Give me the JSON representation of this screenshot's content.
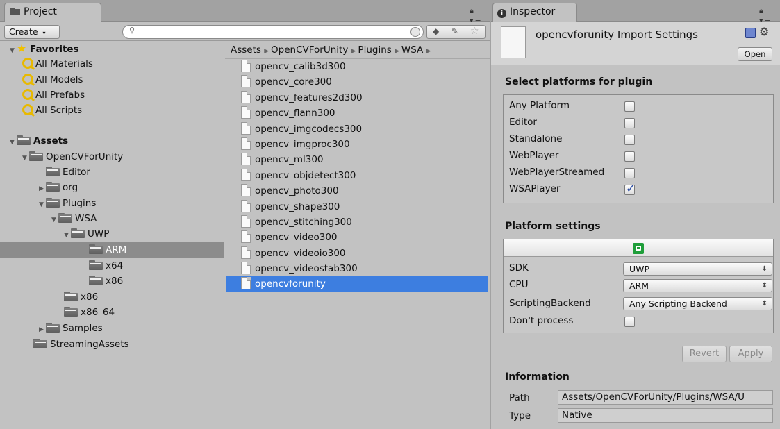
{
  "project": {
    "tab_label": "Project",
    "create_label": "Create",
    "search_placeholder": "",
    "favorites": {
      "label": "Favorites",
      "items": [
        "All Materials",
        "All Models",
        "All Prefabs",
        "All Scripts"
      ]
    },
    "tree": {
      "assets": "Assets",
      "opencv": "OpenCVForUnity",
      "editor": "Editor",
      "org": "org",
      "plugins": "Plugins",
      "wsa": "WSA",
      "uwp": "UWP",
      "arm": "ARM",
      "x64_uwp": "x64",
      "x86_uwp": "x86",
      "x86": "x86",
      "x86_64": "x86_64",
      "samples": "Samples",
      "streaming": "StreamingAssets"
    },
    "breadcrumb": [
      "Assets",
      "OpenCVForUnity",
      "Plugins",
      "WSA"
    ],
    "files": [
      "opencv_calib3d300",
      "opencv_core300",
      "opencv_features2d300",
      "opencv_flann300",
      "opencv_imgcodecs300",
      "opencv_imgproc300",
      "opencv_ml300",
      "opencv_objdetect300",
      "opencv_photo300",
      "opencv_shape300",
      "opencv_stitching300",
      "opencv_video300",
      "opencv_videoio300",
      "opencv_videostab300",
      "opencvforunity"
    ],
    "selected_file": "opencvforunity"
  },
  "inspector": {
    "tab_label": "Inspector",
    "title": "opencvforunity Import Settings",
    "open_label": "Open",
    "platforms_heading": "Select platforms for plugin",
    "platforms": [
      {
        "label": "Any Platform",
        "checked": false
      },
      {
        "label": "Editor",
        "checked": false
      },
      {
        "label": "Standalone",
        "checked": false
      },
      {
        "label": "WebPlayer",
        "checked": false
      },
      {
        "label": "WebPlayerStreamed",
        "checked": false
      },
      {
        "label": "WSAPlayer",
        "checked": true
      }
    ],
    "platform_settings_heading": "Platform settings",
    "settings": {
      "sdk_label": "SDK",
      "sdk_value": "UWP",
      "cpu_label": "CPU",
      "cpu_value": "ARM",
      "backend_label": "ScriptingBackend",
      "backend_value": "Any Scripting Backend",
      "dontprocess_label": "Don't process",
      "dontprocess_checked": false
    },
    "revert_label": "Revert",
    "apply_label": "Apply",
    "information_heading": "Information",
    "path_label": "Path",
    "path_value": "Assets/OpenCVForUnity/Plugins/WSA/U",
    "type_label": "Type",
    "type_value": "Native"
  },
  "colors": {
    "selection_blue": "#3d7ee0",
    "panel_gray": "#c2c2c2",
    "favorite_gold": "#e8b900",
    "wsa_green": "#1f9e3a",
    "checkmark_blue": "#2e4fa5"
  }
}
